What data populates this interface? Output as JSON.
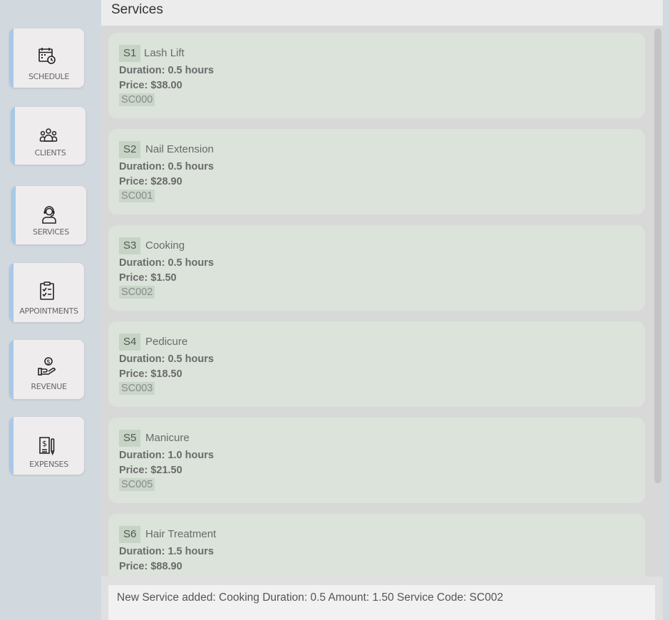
{
  "header": {
    "title": "Services"
  },
  "nav": [
    {
      "label": "SCHEDULE",
      "icon": "calendar-clock-icon"
    },
    {
      "label": "CLIENTS",
      "icon": "people-group-icon"
    },
    {
      "label": "SERVICES",
      "icon": "support-agent-icon"
    },
    {
      "label": "APPOINTMENTS",
      "icon": "clipboard-check-icon"
    },
    {
      "label": "REVENUE",
      "icon": "hand-coin-icon"
    },
    {
      "label": "EXPENSES",
      "icon": "receipt-pen-icon"
    }
  ],
  "services": [
    {
      "index": "S1",
      "name": "Lash Lift",
      "duration": "Duration: 0.5 hours",
      "price": "Price: $38.00",
      "code": "SC000"
    },
    {
      "index": "S2",
      "name": "Nail Extension",
      "duration": "Duration: 0.5 hours",
      "price": "Price: $28.90",
      "code": "SC001"
    },
    {
      "index": "S3",
      "name": "Cooking",
      "duration": "Duration: 0.5 hours",
      "price": "Price: $1.50",
      "code": "SC002"
    },
    {
      "index": "S4",
      "name": "Pedicure",
      "duration": "Duration: 0.5 hours",
      "price": "Price: $18.50",
      "code": "SC003"
    },
    {
      "index": "S5",
      "name": "Manicure",
      "duration": "Duration: 1.0 hours",
      "price": "Price: $21.50",
      "code": "SC005"
    },
    {
      "index": "S6",
      "name": "Hair Treatment",
      "duration": "Duration: 1.5 hours",
      "price": "Price: $88.90",
      "code": ""
    }
  ],
  "status": {
    "message": "New Service added: Cooking Duration: 0.5 Amount: 1.50 Service Code: SC002"
  },
  "colors": {
    "accent": "#a9c8e6",
    "card": "#dbe3db",
    "badge": "#c6d4c6"
  }
}
